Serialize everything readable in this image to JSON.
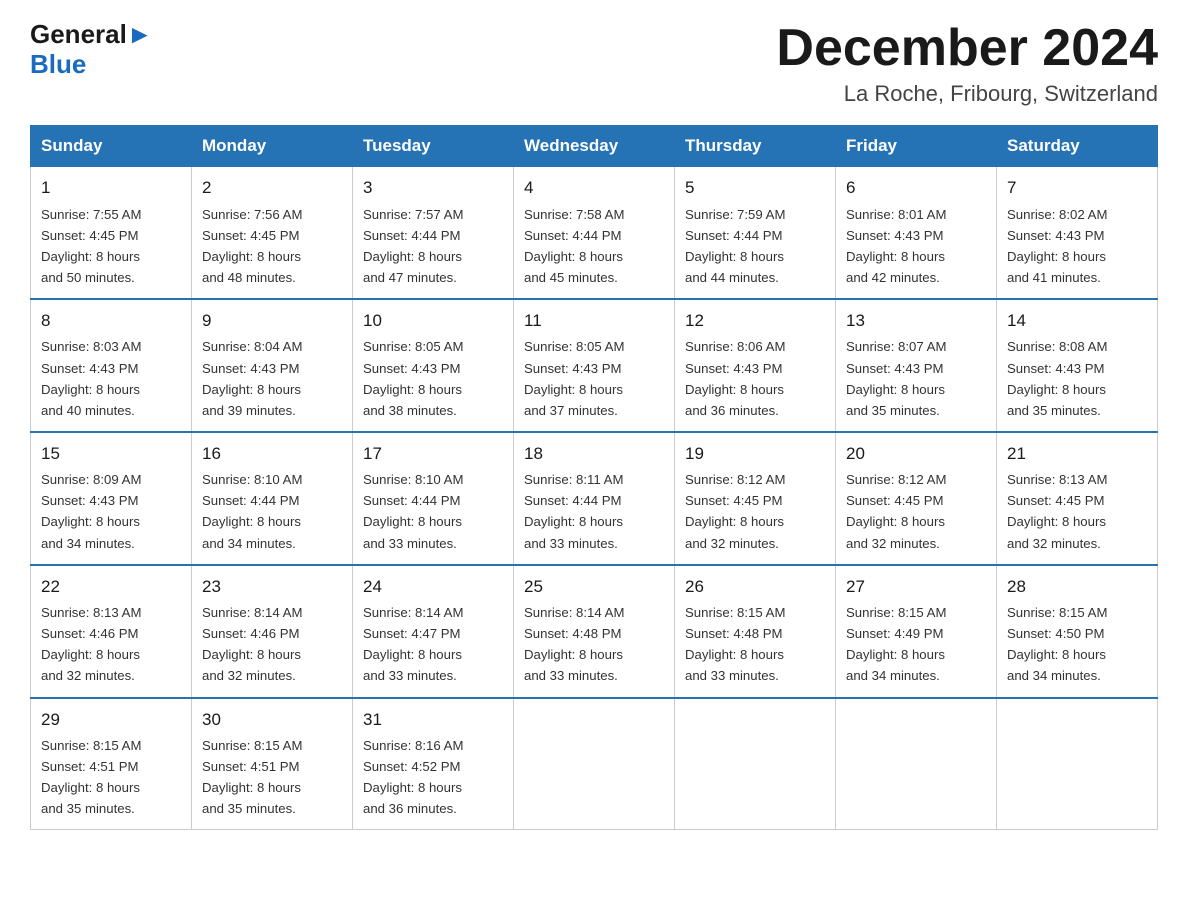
{
  "header": {
    "month_title": "December 2024",
    "location": "La Roche, Fribourg, Switzerland",
    "logo_general": "General",
    "logo_blue": "Blue"
  },
  "days_of_week": [
    "Sunday",
    "Monday",
    "Tuesday",
    "Wednesday",
    "Thursday",
    "Friday",
    "Saturday"
  ],
  "weeks": [
    [
      {
        "day": "1",
        "sunrise": "7:55 AM",
        "sunset": "4:45 PM",
        "daylight": "8 hours and 50 minutes."
      },
      {
        "day": "2",
        "sunrise": "7:56 AM",
        "sunset": "4:45 PM",
        "daylight": "8 hours and 48 minutes."
      },
      {
        "day": "3",
        "sunrise": "7:57 AM",
        "sunset": "4:44 PM",
        "daylight": "8 hours and 47 minutes."
      },
      {
        "day": "4",
        "sunrise": "7:58 AM",
        "sunset": "4:44 PM",
        "daylight": "8 hours and 45 minutes."
      },
      {
        "day": "5",
        "sunrise": "7:59 AM",
        "sunset": "4:44 PM",
        "daylight": "8 hours and 44 minutes."
      },
      {
        "day": "6",
        "sunrise": "8:01 AM",
        "sunset": "4:43 PM",
        "daylight": "8 hours and 42 minutes."
      },
      {
        "day": "7",
        "sunrise": "8:02 AM",
        "sunset": "4:43 PM",
        "daylight": "8 hours and 41 minutes."
      }
    ],
    [
      {
        "day": "8",
        "sunrise": "8:03 AM",
        "sunset": "4:43 PM",
        "daylight": "8 hours and 40 minutes."
      },
      {
        "day": "9",
        "sunrise": "8:04 AM",
        "sunset": "4:43 PM",
        "daylight": "8 hours and 39 minutes."
      },
      {
        "day": "10",
        "sunrise": "8:05 AM",
        "sunset": "4:43 PM",
        "daylight": "8 hours and 38 minutes."
      },
      {
        "day": "11",
        "sunrise": "8:05 AM",
        "sunset": "4:43 PM",
        "daylight": "8 hours and 37 minutes."
      },
      {
        "day": "12",
        "sunrise": "8:06 AM",
        "sunset": "4:43 PM",
        "daylight": "8 hours and 36 minutes."
      },
      {
        "day": "13",
        "sunrise": "8:07 AM",
        "sunset": "4:43 PM",
        "daylight": "8 hours and 35 minutes."
      },
      {
        "day": "14",
        "sunrise": "8:08 AM",
        "sunset": "4:43 PM",
        "daylight": "8 hours and 35 minutes."
      }
    ],
    [
      {
        "day": "15",
        "sunrise": "8:09 AM",
        "sunset": "4:43 PM",
        "daylight": "8 hours and 34 minutes."
      },
      {
        "day": "16",
        "sunrise": "8:10 AM",
        "sunset": "4:44 PM",
        "daylight": "8 hours and 34 minutes."
      },
      {
        "day": "17",
        "sunrise": "8:10 AM",
        "sunset": "4:44 PM",
        "daylight": "8 hours and 33 minutes."
      },
      {
        "day": "18",
        "sunrise": "8:11 AM",
        "sunset": "4:44 PM",
        "daylight": "8 hours and 33 minutes."
      },
      {
        "day": "19",
        "sunrise": "8:12 AM",
        "sunset": "4:45 PM",
        "daylight": "8 hours and 32 minutes."
      },
      {
        "day": "20",
        "sunrise": "8:12 AM",
        "sunset": "4:45 PM",
        "daylight": "8 hours and 32 minutes."
      },
      {
        "day": "21",
        "sunrise": "8:13 AM",
        "sunset": "4:45 PM",
        "daylight": "8 hours and 32 minutes."
      }
    ],
    [
      {
        "day": "22",
        "sunrise": "8:13 AM",
        "sunset": "4:46 PM",
        "daylight": "8 hours and 32 minutes."
      },
      {
        "day": "23",
        "sunrise": "8:14 AM",
        "sunset": "4:46 PM",
        "daylight": "8 hours and 32 minutes."
      },
      {
        "day": "24",
        "sunrise": "8:14 AM",
        "sunset": "4:47 PM",
        "daylight": "8 hours and 33 minutes."
      },
      {
        "day": "25",
        "sunrise": "8:14 AM",
        "sunset": "4:48 PM",
        "daylight": "8 hours and 33 minutes."
      },
      {
        "day": "26",
        "sunrise": "8:15 AM",
        "sunset": "4:48 PM",
        "daylight": "8 hours and 33 minutes."
      },
      {
        "day": "27",
        "sunrise": "8:15 AM",
        "sunset": "4:49 PM",
        "daylight": "8 hours and 34 minutes."
      },
      {
        "day": "28",
        "sunrise": "8:15 AM",
        "sunset": "4:50 PM",
        "daylight": "8 hours and 34 minutes."
      }
    ],
    [
      {
        "day": "29",
        "sunrise": "8:15 AM",
        "sunset": "4:51 PM",
        "daylight": "8 hours and 35 minutes."
      },
      {
        "day": "30",
        "sunrise": "8:15 AM",
        "sunset": "4:51 PM",
        "daylight": "8 hours and 35 minutes."
      },
      {
        "day": "31",
        "sunrise": "8:16 AM",
        "sunset": "4:52 PM",
        "daylight": "8 hours and 36 minutes."
      },
      null,
      null,
      null,
      null
    ]
  ],
  "labels": {
    "sunrise": "Sunrise: ",
    "sunset": "Sunset: ",
    "daylight": "Daylight: "
  }
}
